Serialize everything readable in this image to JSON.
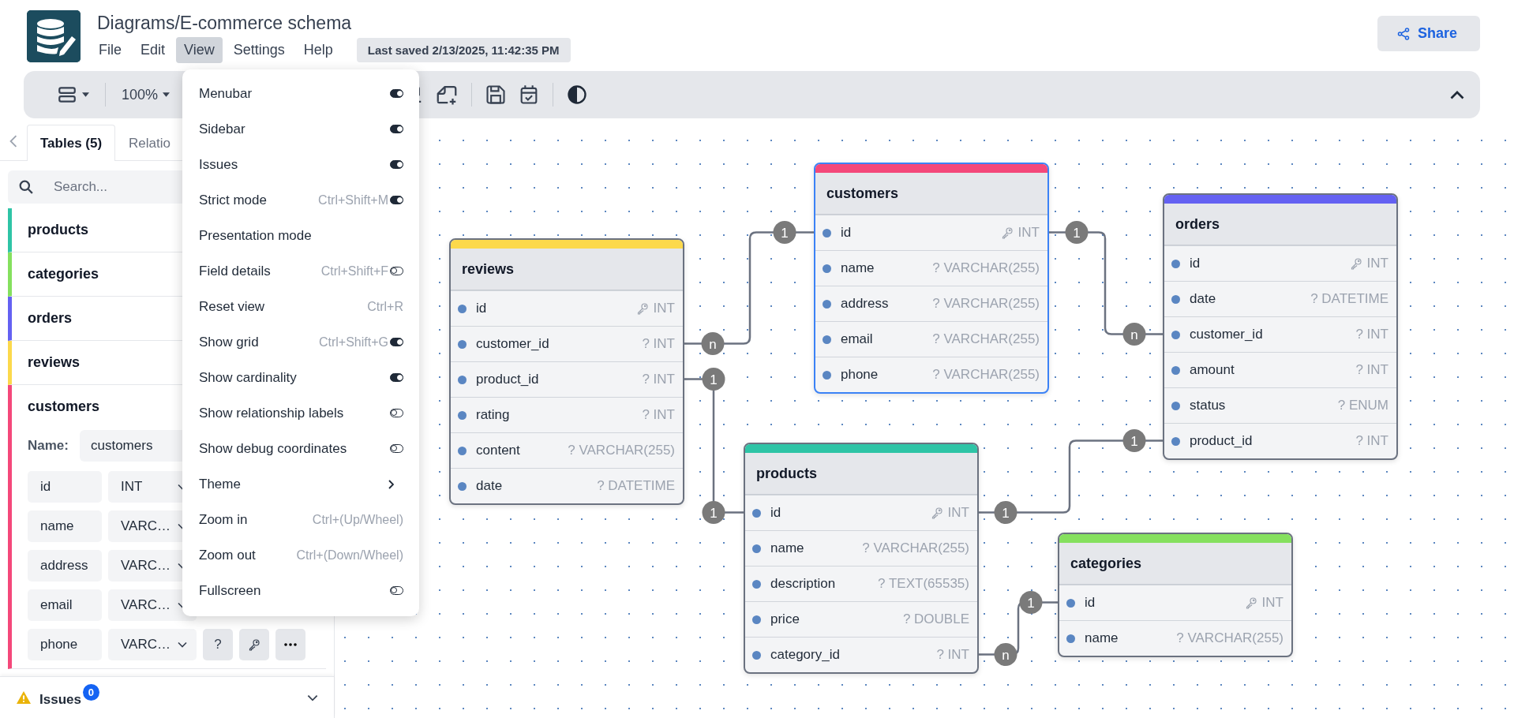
{
  "header": {
    "title": "Diagrams/E-commerce schema",
    "menus": [
      {
        "label": "File",
        "selected": false
      },
      {
        "label": "Edit",
        "selected": false
      },
      {
        "label": "View",
        "selected": true
      },
      {
        "label": "Settings",
        "selected": false
      },
      {
        "label": "Help",
        "selected": false
      }
    ],
    "last_saved": "Last saved 2/13/2025, 11:42:35 PM",
    "share": "Share"
  },
  "toolbar": {
    "zoom": "100%"
  },
  "view_menu": [
    {
      "label": "Menubar",
      "kind": "toggle",
      "on": true
    },
    {
      "label": "Sidebar",
      "kind": "toggle",
      "on": true
    },
    {
      "label": "Issues",
      "kind": "toggle",
      "on": true
    },
    {
      "label": "Strict mode",
      "shortcut": "Ctrl+Shift+M",
      "kind": "toggle",
      "on": true
    },
    {
      "label": "Presentation mode",
      "kind": "plain"
    },
    {
      "label": "Field details",
      "shortcut": "Ctrl+Shift+F",
      "kind": "toggle",
      "on": false
    },
    {
      "label": "Reset view",
      "shortcut": "Ctrl+R",
      "kind": "plain"
    },
    {
      "label": "Show grid",
      "shortcut": "Ctrl+Shift+G",
      "kind": "toggle",
      "on": true
    },
    {
      "label": "Show cardinality",
      "kind": "toggle",
      "on": true
    },
    {
      "label": "Show relationship labels",
      "kind": "toggle",
      "on": false
    },
    {
      "label": "Show debug coordinates",
      "kind": "toggle",
      "on": false
    },
    {
      "label": "Theme",
      "kind": "submenu"
    },
    {
      "label": "Zoom in",
      "shortcut": "Ctrl+(Up/Wheel)",
      "kind": "plain"
    },
    {
      "label": "Zoom out",
      "shortcut": "Ctrl+(Down/Wheel)",
      "kind": "plain"
    },
    {
      "label": "Fullscreen",
      "kind": "toggle",
      "on": false
    }
  ],
  "sidebar": {
    "tabs": [
      {
        "label": "Tables (5)",
        "selected": true
      },
      {
        "label": "Relatio",
        "selected": false
      }
    ],
    "search": {
      "placeholder": "Search..."
    },
    "tables": [
      {
        "name": "products",
        "color": "#2ec4a6",
        "expanded": false
      },
      {
        "name": "categories",
        "color": "#85e05e",
        "expanded": false
      },
      {
        "name": "orders",
        "color": "#6461f2",
        "expanded": false
      },
      {
        "name": "reviews",
        "color": "#fcd94c",
        "expanded": false
      },
      {
        "name": "customers",
        "color": "#f4487a",
        "expanded": true
      }
    ],
    "editor": {
      "name_label": "Name:",
      "name_value": "customers",
      "fields": [
        {
          "name": "id",
          "type": "INT"
        },
        {
          "name": "name",
          "type": "VARC…"
        },
        {
          "name": "address",
          "type": "VARC…"
        },
        {
          "name": "email",
          "type": "VARC…"
        },
        {
          "name": "phone",
          "type": "VARC…",
          "null_label": "?"
        }
      ]
    },
    "issues": {
      "label": "Issues",
      "count": "0"
    }
  },
  "diagram": {
    "tables": [
      {
        "name": "customers",
        "color": "#f4487a",
        "selected": true,
        "fields": [
          {
            "name": "id",
            "type": "INT",
            "primary": true
          },
          {
            "name": "name",
            "type": "? VARCHAR(255)",
            "primary": false
          },
          {
            "name": "address",
            "type": "? VARCHAR(255)",
            "primary": false
          },
          {
            "name": "email",
            "type": "? VARCHAR(255)",
            "primary": false
          },
          {
            "name": "phone",
            "type": "? VARCHAR(255)",
            "primary": false
          }
        ]
      },
      {
        "name": "orders",
        "color": "#6461f2",
        "selected": false,
        "fields": [
          {
            "name": "id",
            "type": "INT",
            "primary": true
          },
          {
            "name": "date",
            "type": "? DATETIME",
            "primary": false
          },
          {
            "name": "customer_id",
            "type": "? INT",
            "primary": false
          },
          {
            "name": "amount",
            "type": "? INT",
            "primary": false
          },
          {
            "name": "status",
            "type": "? ENUM",
            "primary": false
          },
          {
            "name": "product_id",
            "type": "? INT",
            "primary": false
          }
        ]
      },
      {
        "name": "reviews",
        "color": "#fcd94c",
        "selected": false,
        "fields": [
          {
            "name": "id",
            "type": "INT",
            "primary": true
          },
          {
            "name": "customer_id",
            "type": "? INT",
            "primary": false
          },
          {
            "name": "product_id",
            "type": "? INT",
            "primary": false
          },
          {
            "name": "rating",
            "type": "? INT",
            "primary": false
          },
          {
            "name": "content",
            "type": "? VARCHAR(255)",
            "primary": false
          },
          {
            "name": "date",
            "type": "? DATETIME",
            "primary": false
          }
        ]
      },
      {
        "name": "products",
        "color": "#2ec4a6",
        "selected": false,
        "fields": [
          {
            "name": "id",
            "type": "INT",
            "primary": true
          },
          {
            "name": "name",
            "type": "? VARCHAR(255)",
            "primary": false
          },
          {
            "name": "description",
            "type": "? TEXT(65535)",
            "primary": false
          },
          {
            "name": "price",
            "type": "? DOUBLE",
            "primary": false
          },
          {
            "name": "category_id",
            "type": "? INT",
            "primary": false
          }
        ]
      },
      {
        "name": "categories",
        "color": "#85e05e",
        "selected": false,
        "fields": [
          {
            "name": "id",
            "type": "INT",
            "primary": true
          },
          {
            "name": "name",
            "type": "? VARCHAR(255)",
            "primary": false
          }
        ]
      }
    ],
    "relationships": [
      {
        "start": "n",
        "end": "1"
      },
      {
        "start": "1",
        "end": "n"
      },
      {
        "start": "1",
        "end": "1"
      },
      {
        "start": "1",
        "end": "1"
      },
      {
        "start": "n",
        "end": "1"
      }
    ]
  }
}
